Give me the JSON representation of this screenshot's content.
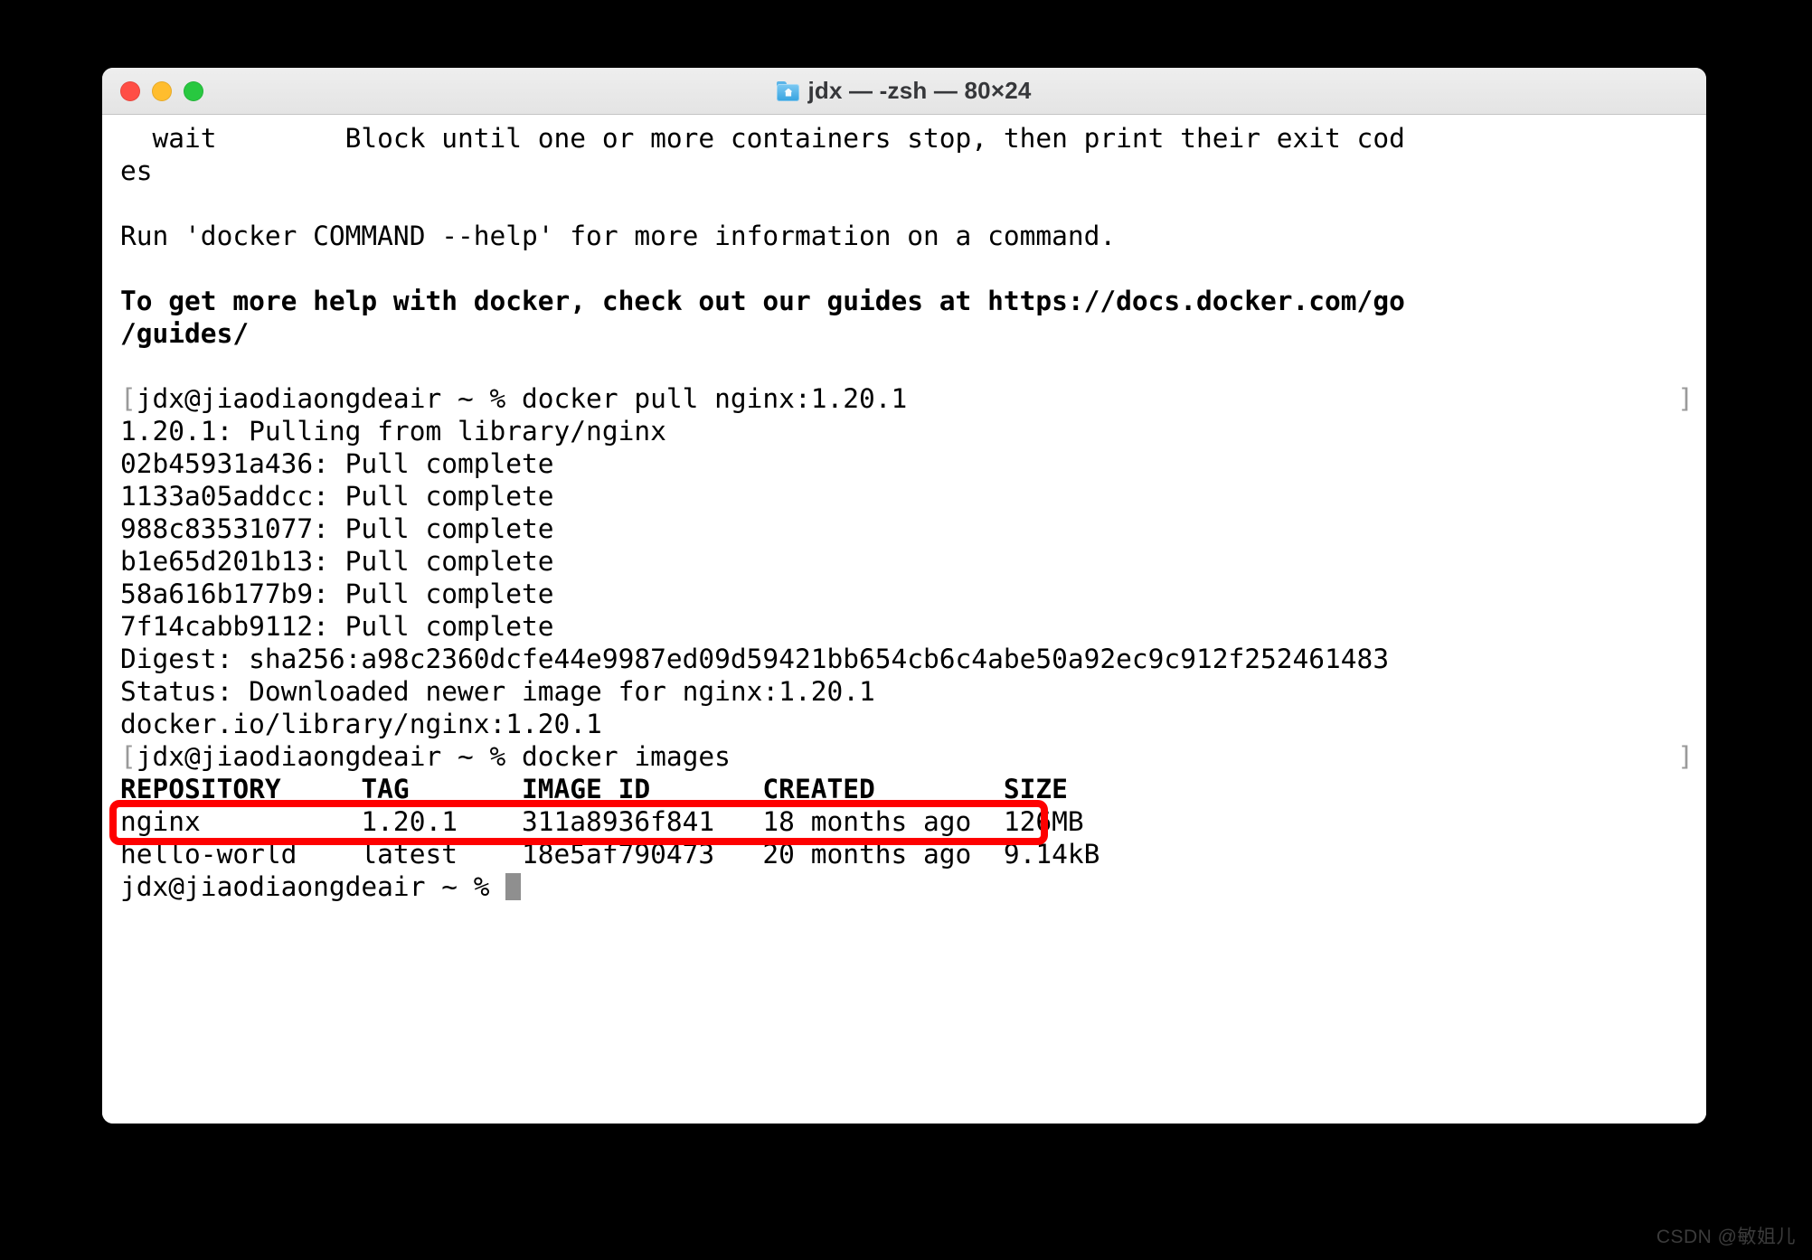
{
  "window": {
    "title": "jdx — -zsh — 80×24",
    "folder_icon": "home-folder-icon",
    "traffic_lights": {
      "close": "close-button",
      "minimize": "minimize-button",
      "zoom": "zoom-button",
      "close_color": "#ff4e45",
      "minimize_color": "#ffbd2e",
      "zoom_color": "#28c840"
    }
  },
  "terminal": {
    "prompt": "jdx@jiaodiaongdeair ~ % ",
    "cursor": "block-cursor",
    "edge_marker_left": "[",
    "edge_marker_right": "]",
    "lines": [
      {
        "text": "  wait        Block until one or more containers stop, then print their exit cod",
        "bold": false
      },
      {
        "text": "es",
        "bold": false
      },
      {
        "text": "",
        "bold": false
      },
      {
        "text": "Run 'docker COMMAND --help' for more information on a command.",
        "bold": false
      },
      {
        "text": "",
        "bold": false
      },
      {
        "text": "To get more help with docker, check out our guides at https://docs.docker.com/go",
        "bold": true
      },
      {
        "text": "/guides/",
        "bold": true
      },
      {
        "text": "",
        "bold": false
      },
      {
        "text": "jdx@jiaodiaongdeair ~ % docker pull nginx:1.20.1",
        "bold": false,
        "prompt": true
      },
      {
        "text": "1.20.1: Pulling from library/nginx",
        "bold": false
      },
      {
        "text": "02b45931a436: Pull complete",
        "bold": false
      },
      {
        "text": "1133a05addcc: Pull complete",
        "bold": false
      },
      {
        "text": "988c83531077: Pull complete",
        "bold": false
      },
      {
        "text": "b1e65d201b13: Pull complete",
        "bold": false
      },
      {
        "text": "58a616b177b9: Pull complete",
        "bold": false
      },
      {
        "text": "7f14cabb9112: Pull complete",
        "bold": false
      },
      {
        "text": "Digest: sha256:a98c2360dcfe44e9987ed09d59421bb654cb6c4abe50a92ec9c912f252461483",
        "bold": false
      },
      {
        "text": "Status: Downloaded newer image for nginx:1.20.1",
        "bold": false
      },
      {
        "text": "docker.io/library/nginx:1.20.1",
        "bold": false
      },
      {
        "text": "jdx@jiaodiaongdeair ~ % docker images",
        "bold": false,
        "prompt": true
      },
      {
        "text": "REPOSITORY     TAG       IMAGE ID       CREATED        SIZE",
        "bold": true
      },
      {
        "text": "nginx          1.20.1    311a8936f841   18 months ago  126MB",
        "bold": false
      },
      {
        "text": "hello-world    latest    18e5af790473   20 months ago  9.14kB",
        "bold": false
      }
    ],
    "images_table": {
      "headers": [
        "REPOSITORY",
        "TAG",
        "IMAGE ID",
        "CREATED",
        "SIZE"
      ],
      "rows": [
        {
          "repository": "nginx",
          "tag": "1.20.1",
          "image_id": "311a8936f841",
          "created": "18 months ago",
          "size": "126MB",
          "highlighted": true
        },
        {
          "repository": "hello-world",
          "tag": "latest",
          "image_id": "18e5af790473",
          "created": "20 months ago",
          "size": "9.14kB",
          "highlighted": false
        }
      ]
    },
    "commands": [
      "docker pull nginx:1.20.1",
      "docker images"
    ]
  },
  "annotation": {
    "highlight_color": "#fe0000",
    "target_row": "nginx 1.20.1 311a8936f841 18 months ago 126MB"
  },
  "watermark": {
    "text": "CSDN @敏姐儿"
  }
}
